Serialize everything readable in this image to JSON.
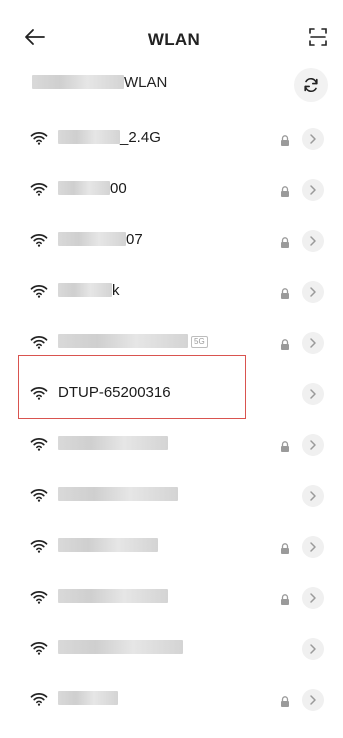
{
  "header": {
    "title": "WLAN",
    "back_icon": "back-arrow-icon",
    "scan_icon": "scan-icon"
  },
  "section": {
    "label": "WLAN",
    "refresh_icon": "refresh-icon"
  },
  "networks": [
    {
      "ssid": "_2.4G",
      "locked": true
    },
    {
      "ssid": "00",
      "locked": true
    },
    {
      "ssid": "07",
      "locked": true
    },
    {
      "ssid": "k",
      "locked": true
    },
    {
      "ssid": "",
      "badge": "5G",
      "locked": true
    },
    {
      "ssid": "DTUP-65200316",
      "locked": false
    },
    {
      "ssid": "",
      "locked": true
    },
    {
      "ssid": "",
      "locked": false
    },
    {
      "ssid": "",
      "locked": true
    },
    {
      "ssid": "",
      "locked": true
    },
    {
      "ssid": "",
      "locked": false
    },
    {
      "ssid": "",
      "locked": true
    }
  ],
  "colors": {
    "highlight_border": "#d9534f",
    "chevron_bg": "#f0f0f0",
    "lock": "#9a9a9a"
  }
}
